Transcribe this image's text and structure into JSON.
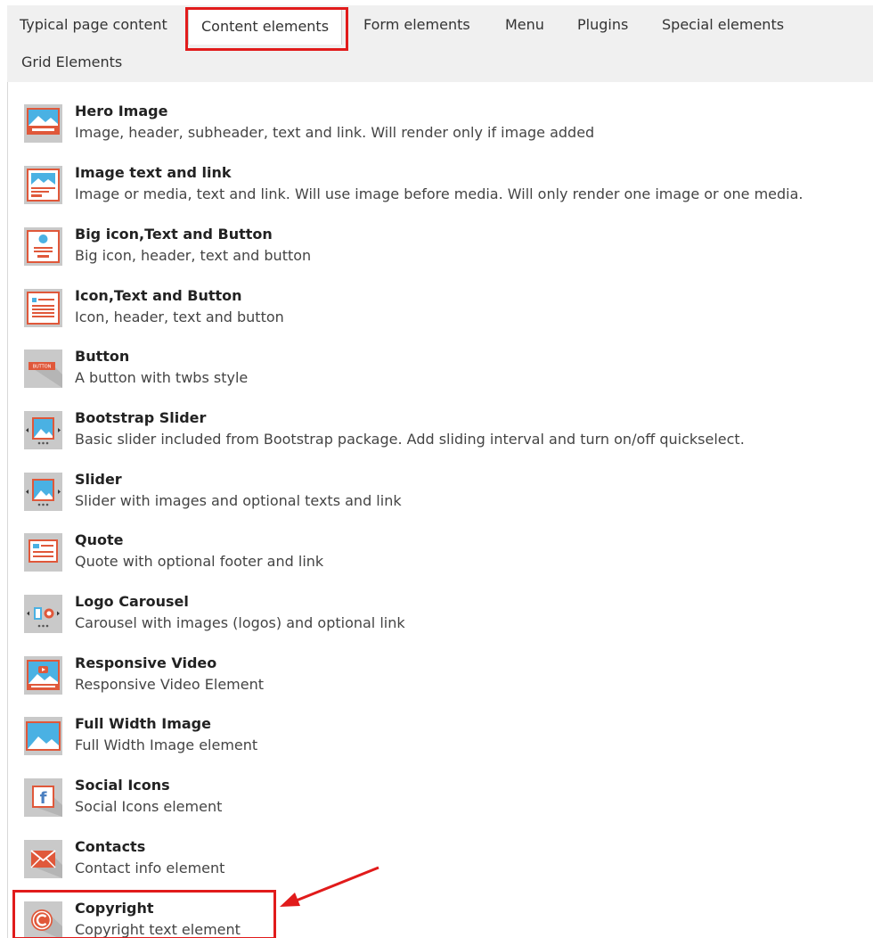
{
  "tabs": [
    {
      "label": "Typical page content"
    },
    {
      "label": "Content elements"
    },
    {
      "label": "Form elements"
    },
    {
      "label": "Menu"
    },
    {
      "label": "Plugins"
    },
    {
      "label": "Special elements"
    },
    {
      "label": "Grid Elements"
    }
  ],
  "active_tab": "Content elements",
  "items": [
    {
      "title": "Hero Image",
      "description": "Image, header, subheader, text and link. Will render only if image added",
      "icon": "hero-image-icon"
    },
    {
      "title": "Image text and link",
      "description": "Image or media, text and link. Will use image before media. Will only render one image or one media.",
      "icon": "image-text-link-icon"
    },
    {
      "title": "Big icon,Text and Button",
      "description": "Big icon, header, text and button",
      "icon": "big-icon-icon"
    },
    {
      "title": "Icon,Text and Button",
      "description": "Icon, header, text and button",
      "icon": "icon-text-button-icon"
    },
    {
      "title": "Button",
      "description": "A button with twbs style",
      "icon": "button-icon",
      "icon_text": "BUTTON"
    },
    {
      "title": "Bootstrap Slider",
      "description": "Basic slider included from Bootstrap package. Add sliding interval and turn on/off quickselect.",
      "icon": "bootstrap-slider-icon"
    },
    {
      "title": "Slider",
      "description": "Slider with images and optional texts and link",
      "icon": "slider-icon"
    },
    {
      "title": "Quote",
      "description": "Quote with optional footer and link",
      "icon": "quote-icon"
    },
    {
      "title": "Logo Carousel",
      "description": "Carousel with images (logos) and optional link",
      "icon": "logo-carousel-icon"
    },
    {
      "title": "Responsive Video",
      "description": "Responsive Video Element",
      "icon": "video-icon"
    },
    {
      "title": "Full Width Image",
      "description": "Full Width Image element",
      "icon": "full-width-image-icon"
    },
    {
      "title": "Social Icons",
      "description": "Social Icons element",
      "icon": "social-icons-icon",
      "icon_text": "f"
    },
    {
      "title": "Contacts",
      "description": "Contact info element",
      "icon": "contacts-icon"
    },
    {
      "title": "Copyright",
      "description": "Copyright text element",
      "icon": "copyright-icon"
    }
  ],
  "colors": {
    "accent_orange": "#e0583a",
    "highlight_red": "#e11b1b",
    "sky_blue": "#4ab1e3",
    "icon_grey": "#c9c9c9"
  }
}
